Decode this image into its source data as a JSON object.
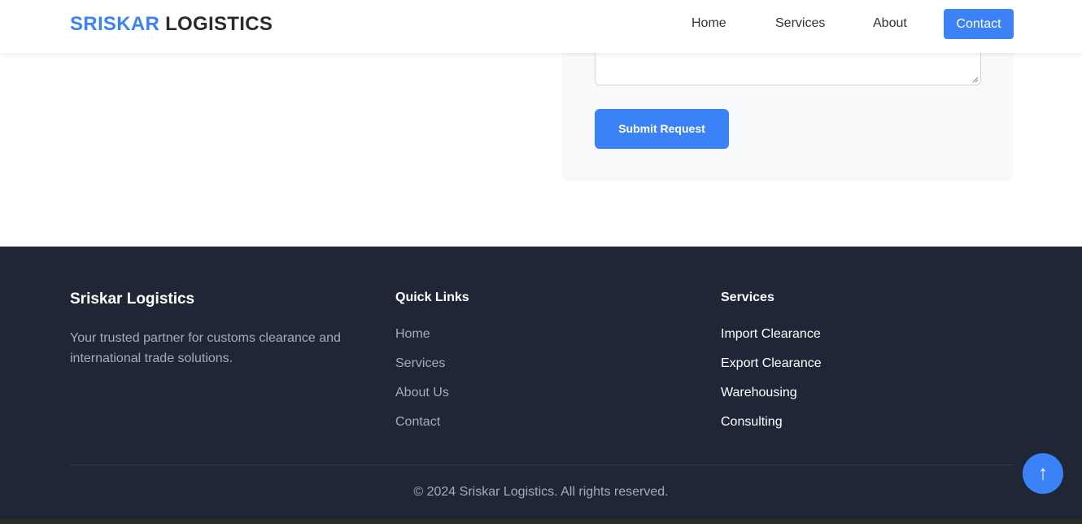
{
  "header": {
    "logo_primary": "SRISKAR",
    "logo_secondary": "LOGISTICS",
    "nav": {
      "home": "Home",
      "services": "Services",
      "about": "About",
      "contact": "Contact"
    }
  },
  "form": {
    "submit_label": "Submit Request"
  },
  "footer": {
    "brand_title": "Sriskar Logistics",
    "description": "Your trusted partner for customs clearance and international trade solutions.",
    "quick_links_title": "Quick Links",
    "quick_links": [
      "Home",
      "Services",
      "About Us",
      "Contact"
    ],
    "services_title": "Services",
    "services": [
      "Import Clearance",
      "Export Clearance",
      "Warehousing",
      "Consulting"
    ],
    "copyright": "© 2024 Sriskar Logistics. All rights reserved."
  },
  "back_to_top": {
    "icon": "arrow-up-icon",
    "glyph": "↑"
  },
  "colors": {
    "accent": "#3b82f6",
    "footer_bg": "#1f2737",
    "muted_text": "#a4acb8"
  }
}
